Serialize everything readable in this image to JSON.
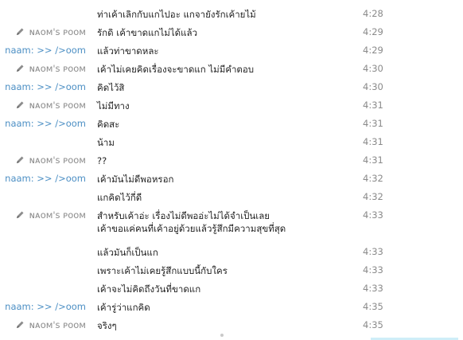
{
  "window": {
    "accent_color": "#cfeef8"
  },
  "participants": {
    "self": {
      "name": "naam: >> />oom",
      "color": "#4c8fc4"
    },
    "other": {
      "name": "ɴᴀᴏᴍ's ᴘᴏᴏᴍ",
      "color": "#8c8c8c",
      "icon": "pencil-icon"
    }
  },
  "messages": [
    {
      "sender": "",
      "sender_class": "",
      "text": "ท่าเค้าเลิกกับแกไปอะ แกจายังรักเค้ายไม้",
      "time": "4:28",
      "lines": 1
    },
    {
      "sender": "ɴᴀᴏᴍ's ᴘᴏᴏᴍ",
      "sender_class": "s2",
      "text": "รักดิ เค้าขาดแกไม่ได้แล้ว",
      "time": "4:29",
      "lines": 1
    },
    {
      "sender": "naam: >> />oom",
      "sender_class": "s1",
      "text": "แล้วท่าขาดหละ",
      "time": "4:29",
      "lines": 1
    },
    {
      "sender": "ɴᴀᴏᴍ's ᴘᴏᴏᴍ",
      "sender_class": "s2",
      "text": "เค้าไม่เคยคิดเรื่องจะขาดแก ไม่มีคำตอบ",
      "time": "4:30",
      "lines": 1
    },
    {
      "sender": "naam: >> />oom",
      "sender_class": "s1",
      "text": "คิดไว้สิ",
      "time": "4:30",
      "lines": 1
    },
    {
      "sender": "ɴᴀᴏᴍ's ᴘᴏᴏᴍ",
      "sender_class": "s2",
      "text": "ไม่มีทาง",
      "time": "4:31",
      "lines": 1
    },
    {
      "sender": "naam: >> />oom",
      "sender_class": "s1",
      "text": "คิดสะ",
      "time": "4:31",
      "lines": 1
    },
    {
      "sender": "",
      "sender_class": "",
      "text": "น้าม",
      "time": "4:31",
      "lines": 1
    },
    {
      "sender": "ɴᴀᴏᴍ's ᴘᴏᴏᴍ",
      "sender_class": "s2",
      "text": "??",
      "time": "4:31",
      "lines": 1
    },
    {
      "sender": "naam: >> />oom",
      "sender_class": "s1",
      "text": "เค้ามันไม่ดีพอหรอก",
      "time": "4:32",
      "lines": 1
    },
    {
      "sender": "",
      "sender_class": "",
      "text": "แกคิดไว้กี่ดี",
      "time": "4:32",
      "lines": 1
    },
    {
      "sender": "ɴᴀᴏᴍ's ᴘᴏᴏᴍ",
      "sender_class": "s2",
      "text": "สำหรับเค้าอ่ะ เรื่องไม่ดีพออ่ะไม่ได้จำเป็นเลย\nเค้าขอแค่คนที่เค้าอยู่ด้วยแล้วรู้สึกมีความสุขที่สุด",
      "time": "4:33",
      "lines": 2
    },
    {
      "sender": "",
      "sender_class": "",
      "text": "แล้วมันก็เป็นแก",
      "time": "4:33",
      "lines": 1
    },
    {
      "sender": "",
      "sender_class": "",
      "text": "เพราะเค้าไม่เคยรู้สึกแบบนี้กับใคร",
      "time": "4:33",
      "lines": 1
    },
    {
      "sender": "",
      "sender_class": "",
      "text": "เค้าจะไม่คิดถึงวันที่ขาดแก",
      "time": "4:33",
      "lines": 1
    },
    {
      "sender": "naam: >> />oom",
      "sender_class": "s1",
      "text": "เค้ารู่ว่าแกคิด",
      "time": "4:35",
      "lines": 1
    },
    {
      "sender": "ɴᴀᴏᴍ's ᴘᴏᴏᴍ",
      "sender_class": "s2",
      "text": "จริงๆ",
      "time": "4:35",
      "lines": 1
    }
  ]
}
